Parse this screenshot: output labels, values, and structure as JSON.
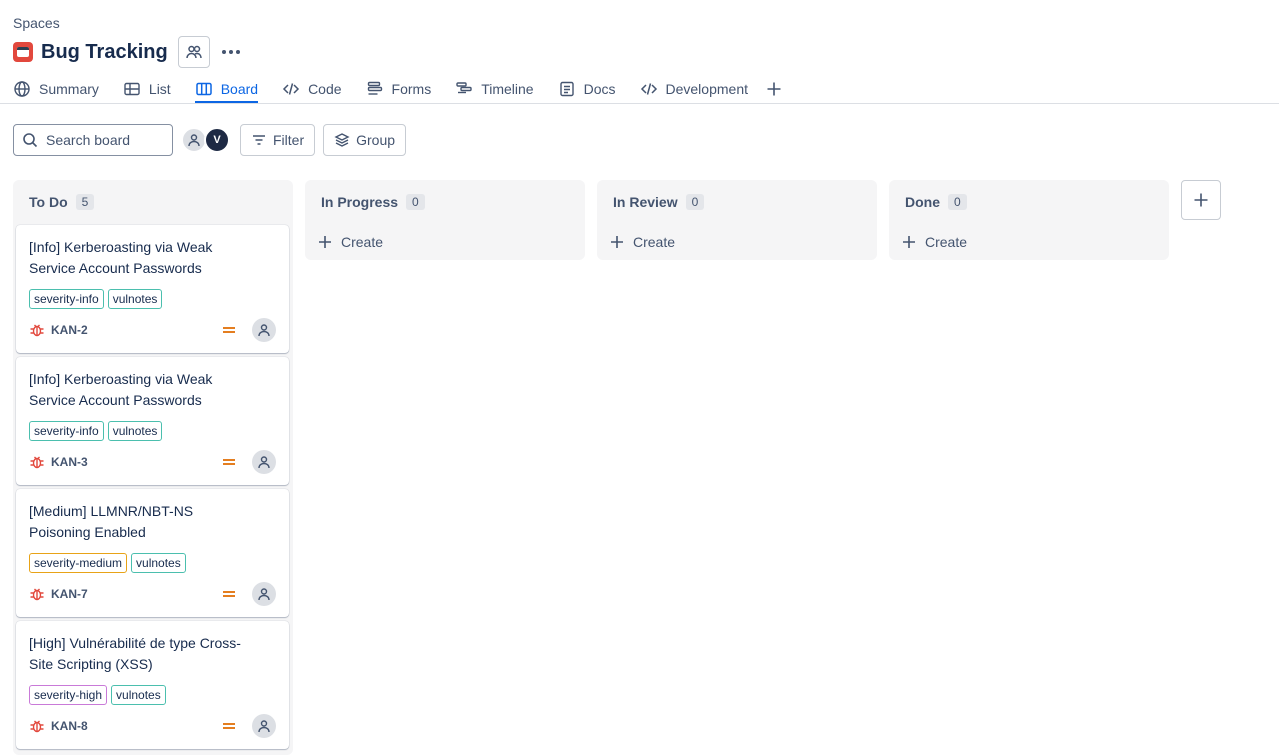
{
  "breadcrumb": "Spaces",
  "project": {
    "title": "Bug Tracking",
    "icon": "project-calendar-icon",
    "brand_color": "#e2483d"
  },
  "tabs": [
    {
      "label": "Summary",
      "icon": "globe-icon"
    },
    {
      "label": "List",
      "icon": "list-table-icon"
    },
    {
      "label": "Board",
      "icon": "board-icon",
      "active": true
    },
    {
      "label": "Code",
      "icon": "code-icon"
    },
    {
      "label": "Forms",
      "icon": "forms-icon"
    },
    {
      "label": "Timeline",
      "icon": "timeline-icon"
    },
    {
      "label": "Docs",
      "icon": "docs-icon"
    },
    {
      "label": "Development",
      "icon": "development-icon"
    }
  ],
  "toolbar": {
    "search_placeholder": "Search board",
    "avatar_letter": "V",
    "filter_label": "Filter",
    "group_label": "Group"
  },
  "columns": [
    {
      "title": "To Do",
      "count": "5"
    },
    {
      "title": "In Progress",
      "count": "0",
      "create_label": "Create"
    },
    {
      "title": "In Review",
      "count": "0",
      "create_label": "Create"
    },
    {
      "title": "Done",
      "count": "0",
      "create_label": "Create"
    }
  ],
  "cards": [
    {
      "title": "[Info] Kerberoasting via Weak Service Account Passwords",
      "labels": [
        "severity-info",
        "vulnotes"
      ],
      "key": "KAN-2",
      "priority": "medium"
    },
    {
      "title": "[Info] Kerberoasting via Weak Service Account Passwords",
      "labels": [
        "severity-info",
        "vulnotes"
      ],
      "key": "KAN-3",
      "priority": "medium"
    },
    {
      "title": "[Medium] LLMNR/NBT-NS Poisoning Enabled",
      "labels": [
        "severity-medium",
        "vulnotes"
      ],
      "key": "KAN-7",
      "priority": "medium"
    },
    {
      "title": "[High] Vulnérabilité de type Cross-Site Scripting (XSS)",
      "labels": [
        "severity-high",
        "vulnotes"
      ],
      "key": "KAN-8",
      "priority": "medium"
    }
  ],
  "colors": {
    "accent": "#0c66e4",
    "bug": "#e2483d",
    "priority_medium": "#e06c00",
    "label_info": "#4bbfae",
    "label_medium": "#e8a317",
    "label_high": "#c97ad8"
  }
}
